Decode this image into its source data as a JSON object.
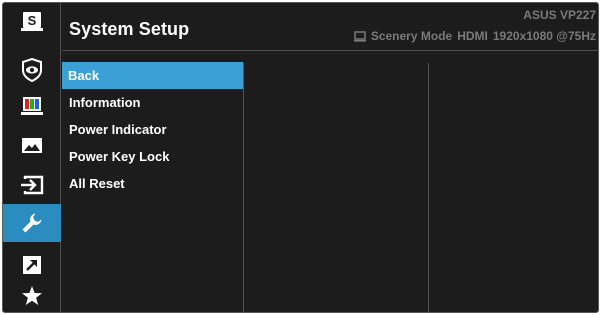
{
  "header": {
    "title": "System Setup",
    "model": "ASUS  VP227",
    "mode": "Scenery Mode",
    "input": "HDMI",
    "resolution": "1920x1080 @75Hz"
  },
  "rail": {
    "items": [
      {
        "icon": "splendid-icon",
        "active": false
      },
      {
        "icon": "eye-care-icon",
        "active": false
      },
      {
        "icon": "color-icon",
        "active": false
      },
      {
        "icon": "image-icon",
        "active": false
      },
      {
        "icon": "input-select-icon",
        "active": false
      },
      {
        "icon": "system-setup-wrench-icon",
        "active": true
      },
      {
        "icon": "shortcut-icon",
        "active": false
      },
      {
        "icon": "my-favorite-star-icon",
        "active": false
      }
    ]
  },
  "menu": {
    "items": [
      {
        "label": "Back",
        "active": true
      },
      {
        "label": "Information",
        "active": false
      },
      {
        "label": "Power Indicator",
        "active": false
      },
      {
        "label": "Power Key Lock",
        "active": false
      },
      {
        "label": "All Reset",
        "active": false
      }
    ]
  },
  "colors": {
    "background": "#1c1c1c",
    "accent": "#3aa0d6",
    "rail_active": "#2b8cc0",
    "text": "#ffffff",
    "muted_text": "#7a7a7a",
    "divider": "#555555"
  }
}
